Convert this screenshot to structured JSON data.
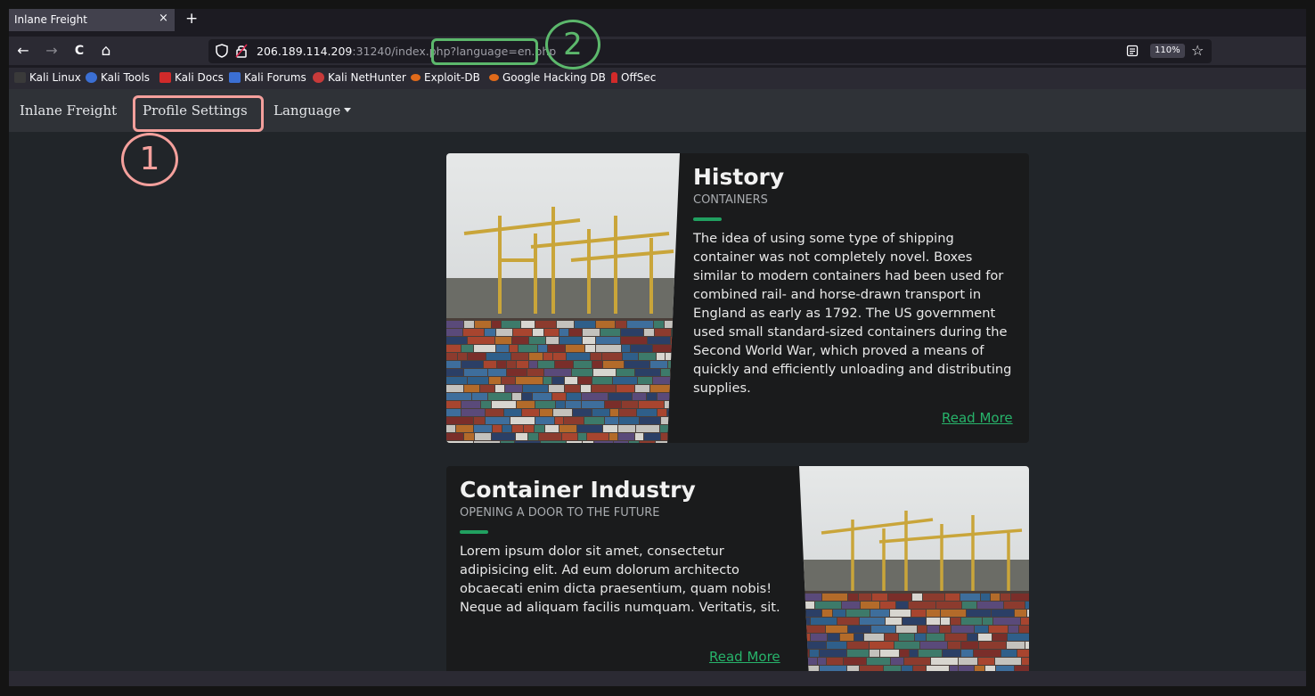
{
  "browser": {
    "tab": {
      "title": "Inlane Freight",
      "close": "×"
    },
    "new_tab": "+",
    "url": {
      "host": "206.189.114.209",
      "rest": ":31240/index.php?language=en.php"
    },
    "zoom": "110%",
    "icons": {
      "back": "←",
      "forward": "→",
      "reload": "C",
      "home": "⌂",
      "star": "☆"
    },
    "bookmarks": [
      {
        "label": "Kali Linux",
        "color": "#3a3a3a"
      },
      {
        "label": "Kali Tools",
        "color": "#3b6fd4"
      },
      {
        "label": "Kali Docs",
        "color": "#d12a2a"
      },
      {
        "label": "Kali Forums",
        "color": "#3b6fd4"
      },
      {
        "label": "Kali NetHunter",
        "color": "#c83a3a"
      },
      {
        "label": "Exploit-DB",
        "color": "#e06a1a"
      },
      {
        "label": "Google Hacking DB",
        "color": "#e06a1a"
      },
      {
        "label": "OffSec",
        "color": "#d22a2a"
      }
    ]
  },
  "site": {
    "brand": "Inlane Freight",
    "nav": {
      "profile": "Profile Settings",
      "language": "Language"
    },
    "cards": [
      {
        "title": "History",
        "subtitle": "CONTAINERS",
        "text": "The idea of using some type of shipping container was not completely novel. Boxes similar to modern containers had been used for combined rail- and horse-drawn transport in England as early as 1792. The US government used small standard-sized containers during the Second World War, which proved a means of quickly and efficiently unloading and distributing supplies.",
        "link": "Read More"
      },
      {
        "title": "Container Industry",
        "subtitle": "OPENING A DOOR TO THE FUTURE",
        "text": "Lorem ipsum dolor sit amet, consectetur adipisicing elit. Ad eum dolorum architecto obcaecati enim dicta praesentium, quam nobis! Neque ad aliquam facilis numquam. Veritatis, sit.",
        "link": "Read More"
      }
    ]
  },
  "annotations": {
    "one": {
      "label": "1",
      "color": "#f4a09c"
    },
    "two": {
      "label": "2",
      "color": "#5cb86c"
    }
  }
}
